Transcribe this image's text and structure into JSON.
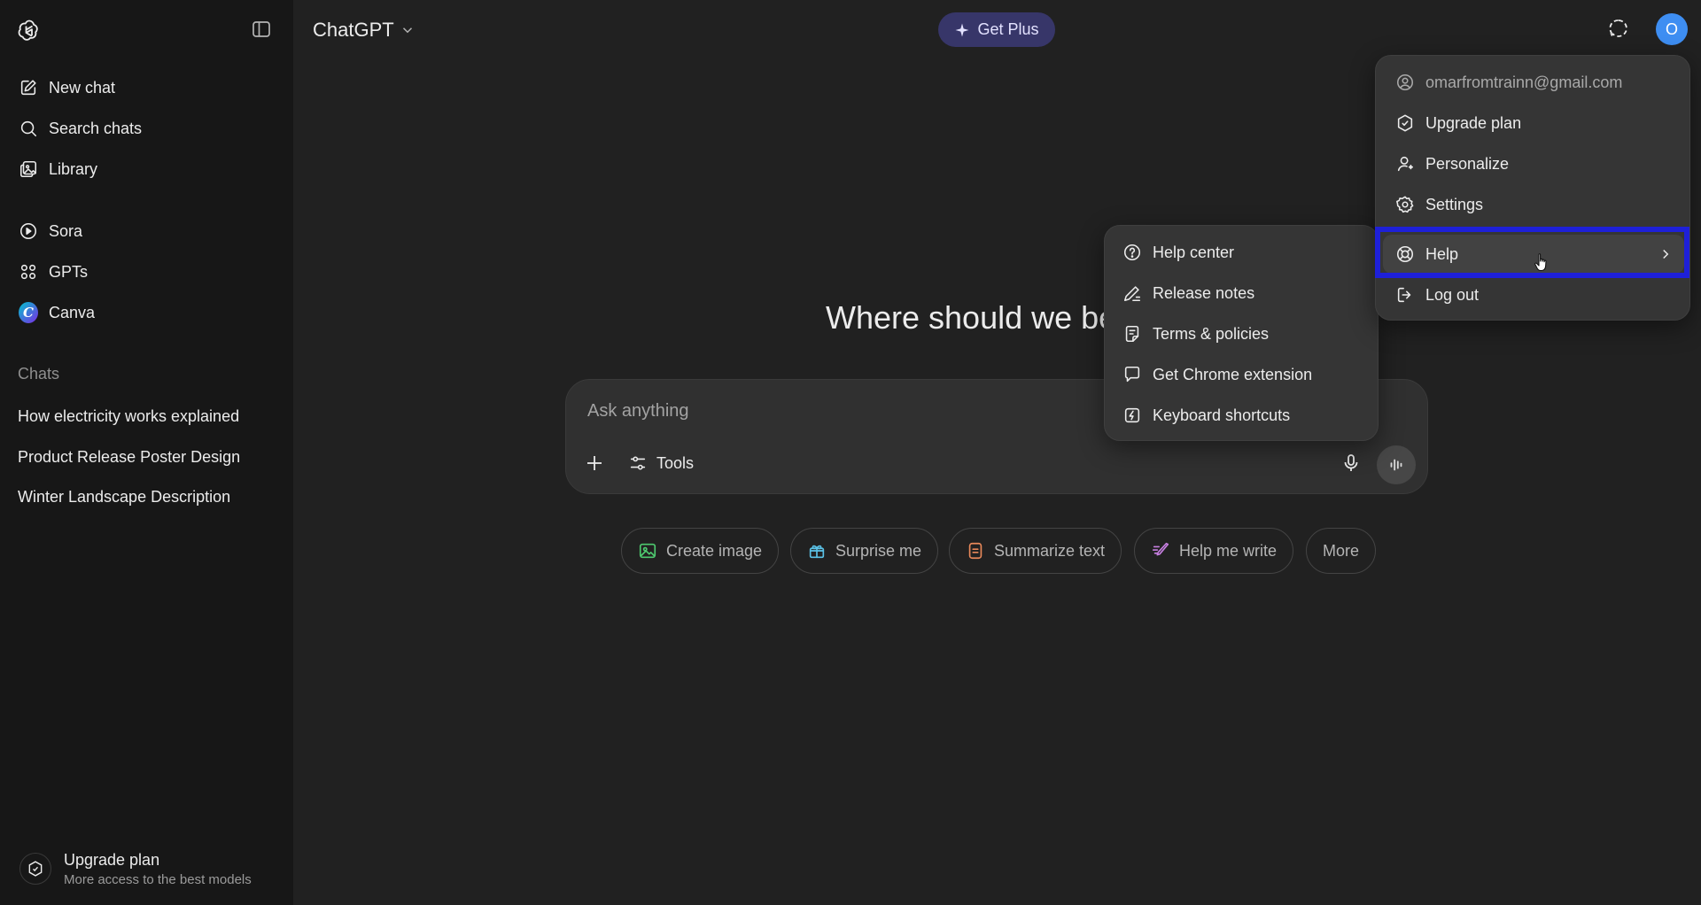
{
  "sidebar": {
    "nav": [
      {
        "label": "New chat",
        "icon": "new-chat-icon"
      },
      {
        "label": "Search chats",
        "icon": "search-icon"
      },
      {
        "label": "Library",
        "icon": "library-icon"
      }
    ],
    "apps": [
      {
        "label": "Sora",
        "icon": "play-circle-icon"
      },
      {
        "label": "GPTs",
        "icon": "grid-icon"
      },
      {
        "label": "Canva",
        "icon": "canva-icon"
      }
    ],
    "chats_heading": "Chats",
    "chats": [
      "How electricity works explained",
      "Product Release Poster Design",
      "Winter Landscape Description"
    ],
    "upgrade": {
      "title": "Upgrade plan",
      "subtitle": "More access to the best models"
    }
  },
  "header": {
    "model": "ChatGPT",
    "get_plus": "Get Plus",
    "avatar_initial": "O"
  },
  "main": {
    "heading": "Where should we be",
    "composer": {
      "placeholder": "Ask anything",
      "tools_label": "Tools"
    },
    "chips": [
      {
        "label": "Create image",
        "color": "#4ec96f"
      },
      {
        "label": "Surprise me",
        "color": "#5bc2e7"
      },
      {
        "label": "Summarize text",
        "color": "#e8885a"
      },
      {
        "label": "Help me write",
        "color": "#c67fe0"
      },
      {
        "label": "More"
      }
    ]
  },
  "profile_menu": {
    "email": "omarfromtrainn@gmail.com",
    "items": [
      "Upgrade plan",
      "Personalize",
      "Settings",
      "Help",
      "Log out"
    ]
  },
  "help_menu": {
    "items": [
      "Help center",
      "Release notes",
      "Terms & policies",
      "Get Chrome extension",
      "Keyboard shortcuts"
    ]
  },
  "colors": {
    "background": "#212121",
    "sidebar": "#171717",
    "get_plus_bg": "#373669",
    "avatar": "#3e8ef2",
    "highlight_border": "#1e20d8"
  }
}
